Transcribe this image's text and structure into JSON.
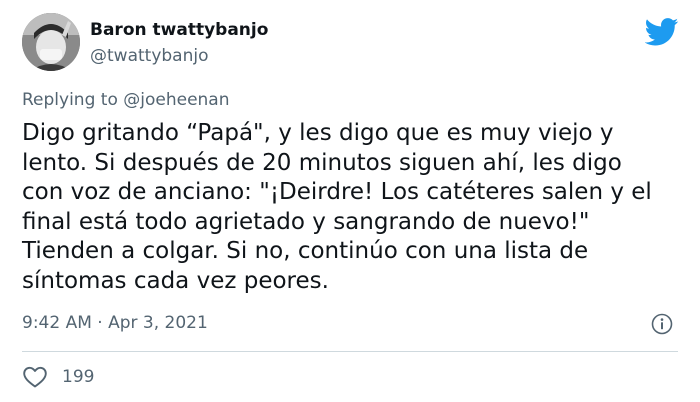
{
  "author": {
    "display_name": "Baron twattybanjo",
    "handle": "@twattybanjo"
  },
  "reply": {
    "prefix": "Replying to",
    "mention": "@joeheenan"
  },
  "tweet": {
    "lines": [
      "Digo gritando “Papá\", y les digo que es muy viejo y",
      "lento. Si después de 20 minutos siguen ahí, les digo",
      "con voz de anciano: \"¡Deirdre! Los catéteres salen y el",
      "final está todo agrietado y sangrando de nuevo!\"",
      "Tienden a colgar. Si no, continúo con una lista de",
      "síntomas cada vez peores."
    ],
    "timestamp": "9:42 AM · Apr 3, 2021"
  },
  "engagement": {
    "likes": "199"
  },
  "icons": {
    "brand": "twitter-bird-icon",
    "info": "info-icon",
    "like": "heart-icon"
  },
  "colors": {
    "brand": "#1d9bf0",
    "secondary_text": "#536471",
    "primary_text": "#0f1419",
    "divider": "#cfd9de"
  }
}
